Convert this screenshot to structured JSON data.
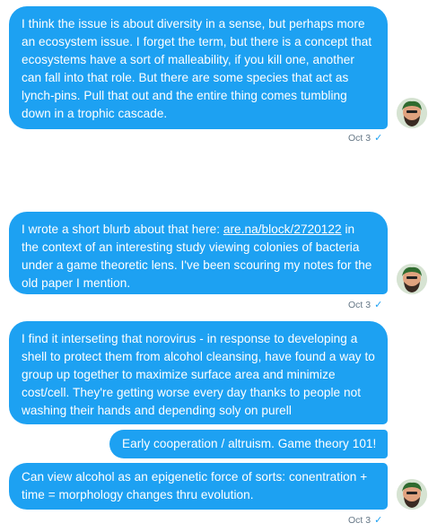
{
  "messages": [
    {
      "text": "I think the issue is about diversity in a sense, but perhaps more an ecosystem issue. I forget the term, but there is a concept that ecosystems have a sort of malleability, if you kill one, another can fall into that role. But there are some species that act as lynch-pins. Pull that out and the entire thing comes tumbling down in a trophic cascade."
    },
    {
      "text_before": "I wrote a short blurb about that here: ",
      "link": "are.na/block/2720122",
      "text_after": " in the context of an interesting study viewing colonies of bacteria under a game theoretic lens. I've been scouring my notes for the old paper I mention."
    },
    {
      "text": "I find it interseting that norovirus - in response to developing a shell to protect them from alcohol cleansing, have found a way to group up together to maximize surface area and minimize cost/cell.  They're getting worse every day thanks to people not washing their hands and depending soly on purell"
    },
    {
      "text": "Early cooperation / altruism. Game theory 101!"
    },
    {
      "text": "Can view alcohol as an epigenetic force of sorts: conentration + time = morphology changes thru evolution."
    }
  ],
  "timestamps": [
    "Oct 3",
    "Oct 3",
    "Oct 3"
  ],
  "read_receipt": "✓",
  "colors": {
    "bubble": "#1da1f2",
    "bubble_text": "#ffffff",
    "meta_text": "#657786",
    "check": "#1da1f2"
  },
  "icons": [
    "avatar",
    "read-receipt-check-icon"
  ]
}
